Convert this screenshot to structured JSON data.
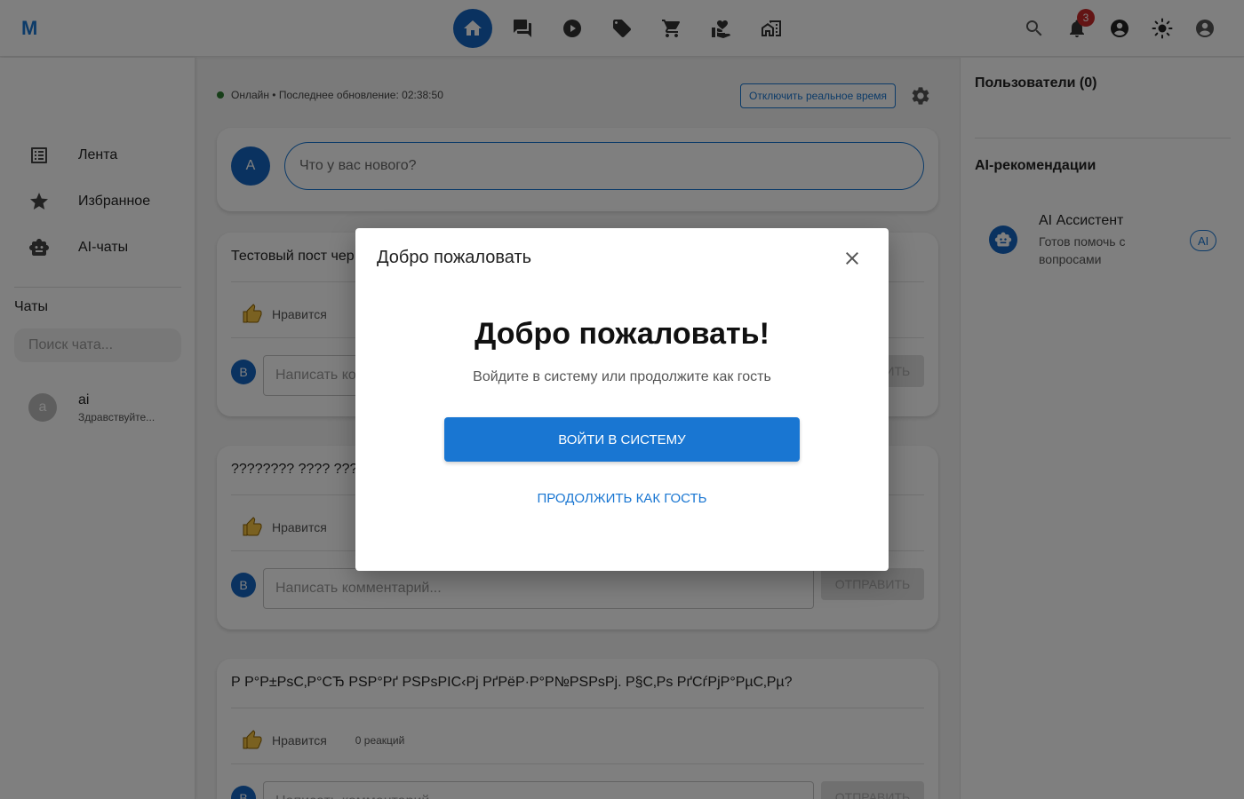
{
  "app": {
    "logo": "M"
  },
  "header": {
    "nav": [
      "home-icon",
      "forum-icon",
      "play-icon",
      "tag-icon",
      "cart-icon",
      "volunteer-icon",
      "houses-icon"
    ],
    "notifications_count": "3"
  },
  "sidebar": {
    "items": [
      {
        "label": "Лента",
        "icon": "feed-icon"
      },
      {
        "label": "Избранное",
        "icon": "star-icon"
      },
      {
        "label": "AI-чаты",
        "icon": "robot-icon"
      }
    ],
    "chats_title": "Чаты",
    "chat_search_placeholder": "Поиск чата...",
    "chats": [
      {
        "avatar": "a",
        "name": "ai",
        "preview": "Здравствуйте..."
      }
    ]
  },
  "feed": {
    "status": "Онлайн • Последнее обновление: 02:38:50",
    "realtime_button": "Отключить реальное время",
    "composer_avatar": "A",
    "composer_placeholder": "Что у вас нового?",
    "posts": [
      {
        "text": "Тестовый пост чер",
        "like_label": "Нравится",
        "reactions": "",
        "comment_avatar": "B",
        "comment_placeholder": "Написать комментарий...",
        "send_label": "ОТПРАВИТЬ"
      },
      {
        "text": "???????? ???? ???",
        "like_label": "Нравится",
        "reactions": "",
        "comment_avatar": "B",
        "comment_placeholder": "Написать комментарий...",
        "send_label": "ОТПРАВИТЬ"
      },
      {
        "text": "Р Р°Р±РѕС‚Р°СЂ РЅР°Рґ РЅРѕРІС‹Рј РґРёР·Р°Р№РЅРѕРј. Р§С‚Рѕ РґСѓРјР°РµС‚Рµ?",
        "like_label": "Нравится",
        "reactions": "0 реакций",
        "comment_avatar": "B",
        "comment_placeholder": "Написать комментарий...",
        "send_label": "ОТПРАВИТЬ"
      }
    ]
  },
  "right": {
    "users_title": "Пользователи (0)",
    "ai_title": "AI-рекомендации",
    "ai_item": {
      "name": "AI Ассистент",
      "desc": "Готов помочь с вопросами",
      "chip": "AI"
    }
  },
  "modal": {
    "title": "Добро пожаловать",
    "heading": "Добро пожаловать!",
    "subtitle": "Войдите в систему или продолжите как гость",
    "login_label": "ВОЙТИ В СИСТЕМУ",
    "guest_label": "ПРОДОЛЖИТЬ КАК ГОСТЬ"
  },
  "colors": {
    "primary": "#1976d2",
    "primary_dark": "#1565c0",
    "badge": "#c62828",
    "online": "#2e7d32"
  }
}
